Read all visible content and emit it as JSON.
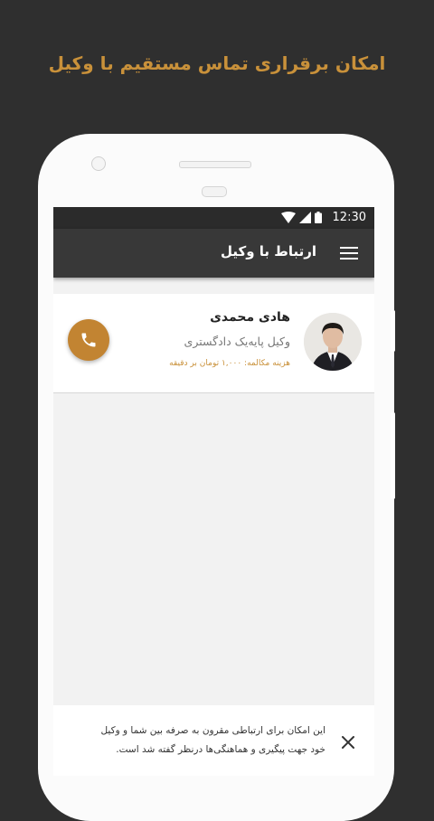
{
  "headline": "امکان برقراری تماس مستقیم با وکیل",
  "status_bar": {
    "time": "12:30",
    "icons": [
      "wifi-icon",
      "signal-icon",
      "battery-icon"
    ]
  },
  "app_bar": {
    "title": "ارتباط با وکیل",
    "menu_icon": "hamburger-menu-icon"
  },
  "lawyer": {
    "name": "هادی محمدی",
    "rank": "وکیل پایه‌یک دادگستری",
    "fee": "هزینه مکالمه: ۱,۰۰۰ تومان بر دقیقه",
    "call_icon": "phone-icon"
  },
  "info": {
    "text": "این امکان برای ارتباطی مقرون به صرفه بین شما و وکیل خود جهت پیگیری و هماهنگی‌ها درنظر گفته شد است.",
    "close_icon": "close-icon"
  },
  "colors": {
    "accent": "#c9913a",
    "call_button": "#c28432",
    "app_bar": "#383838",
    "background": "#2f2f2f"
  }
}
